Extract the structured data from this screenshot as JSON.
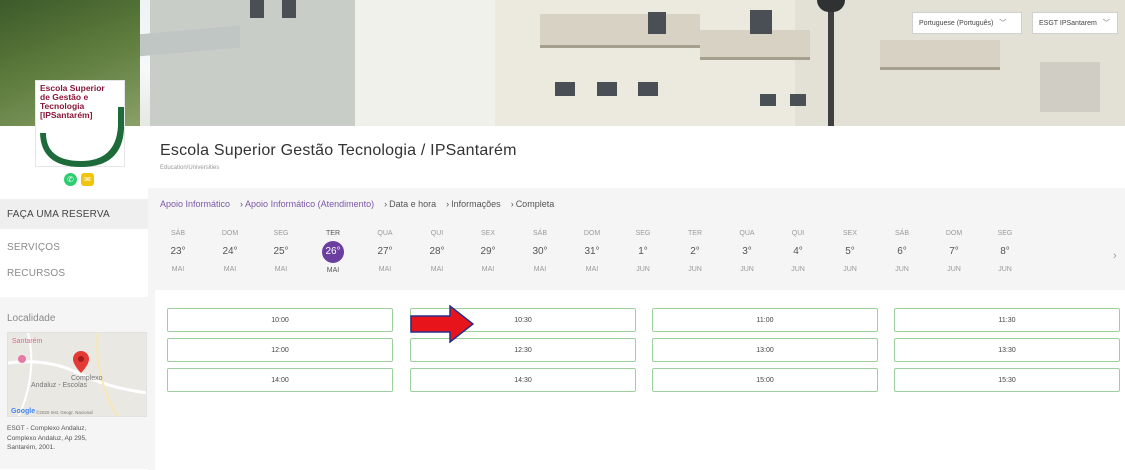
{
  "header": {
    "language_label": "Portuguese (Português)",
    "organization_label": "ESGT IPSantarem"
  },
  "logo": {
    "line1": "Escola Superior",
    "line2": "de Gestão e",
    "line3": "Tecnologia",
    "line4": "[IPSantarém]"
  },
  "social": {
    "icons": [
      "whatsapp-icon",
      "email-icon"
    ]
  },
  "sidebar": {
    "items": [
      {
        "label": "FAÇA UMA RESERVA"
      },
      {
        "label": "SERVIÇOS"
      },
      {
        "label": "RECURSOS"
      }
    ]
  },
  "location": {
    "title": "Localidade",
    "map_place1": "Santarém",
    "map_place2a": "Complexo",
    "map_place2b": "Andaluz - Escolas",
    "map_brand": "Google",
    "map_copyright": "©2020 Inst. Geogr. Nacional",
    "address_line1": "ESGT - Complexo Andaluz,",
    "address_line2": "Complexo Andaluz, Ap 295,",
    "address_line3": "Santarém, 2001."
  },
  "main": {
    "title": "Escola Superior Gestão Tecnologia / IPSantarém",
    "subtitle": "Education/Universities"
  },
  "breadcrumbs": [
    {
      "label": "Apoio Informático",
      "arrow": ""
    },
    {
      "label": "Apoio Informático (Atendimento)",
      "arrow": "›"
    },
    {
      "label": "Data e hora",
      "arrow": "›"
    },
    {
      "label": "Informações",
      "arrow": "›"
    },
    {
      "label": "Completa",
      "arrow": "›"
    }
  ],
  "days": [
    {
      "dow": "SÁB",
      "num": "23°",
      "mon": "MAI"
    },
    {
      "dow": "DOM",
      "num": "24°",
      "mon": "MAI"
    },
    {
      "dow": "SEG",
      "num": "25°",
      "mon": "MAI"
    },
    {
      "dow": "TER",
      "num": "26°",
      "mon": "MAI"
    },
    {
      "dow": "QUA",
      "num": "27°",
      "mon": "MAI"
    },
    {
      "dow": "QUI",
      "num": "28°",
      "mon": "MAI"
    },
    {
      "dow": "SEX",
      "num": "29°",
      "mon": "MAI"
    },
    {
      "dow": "SÁB",
      "num": "30°",
      "mon": "MAI"
    },
    {
      "dow": "DOM",
      "num": "31°",
      "mon": "MAI"
    },
    {
      "dow": "SEG",
      "num": "1°",
      "mon": "JUN"
    },
    {
      "dow": "TER",
      "num": "2°",
      "mon": "JUN"
    },
    {
      "dow": "QUA",
      "num": "3°",
      "mon": "JUN"
    },
    {
      "dow": "QUI",
      "num": "4°",
      "mon": "JUN"
    },
    {
      "dow": "SEX",
      "num": "5°",
      "mon": "JUN"
    },
    {
      "dow": "SÁB",
      "num": "6°",
      "mon": "JUN"
    },
    {
      "dow": "DOM",
      "num": "7°",
      "mon": "JUN"
    },
    {
      "dow": "SEG",
      "num": "8°",
      "mon": "JUN"
    }
  ],
  "selected_day_index": 3,
  "next_arrow": "›",
  "time_slots": [
    "10:00",
    "10:30",
    "11:00",
    "11:30",
    "12:00",
    "12:30",
    "13:00",
    "13:30",
    "14:00",
    "14:30",
    "15:00",
    "15:30"
  ],
  "colors": {
    "accent": "#6b3fa0",
    "link": "#7b57a8",
    "slot_border": "#9ed09e",
    "arrow": "#e8141c"
  }
}
